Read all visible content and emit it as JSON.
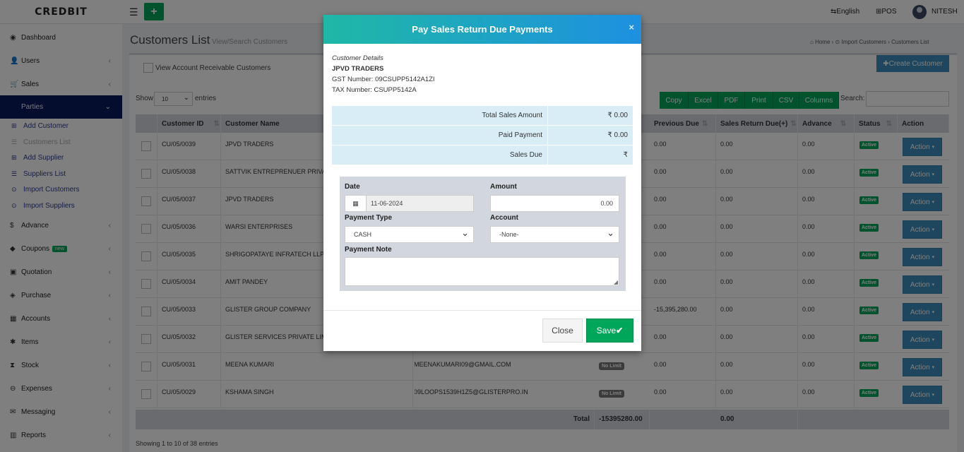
{
  "header": {
    "logo": "CREDBIT",
    "language": "English",
    "pos": "POS",
    "user": "NITESH"
  },
  "sidebar": {
    "items": [
      {
        "label": "Dashboard",
        "icon": "dashboard-icon"
      },
      {
        "label": "Users",
        "icon": "users-icon"
      },
      {
        "label": "Sales",
        "icon": "cart-icon"
      },
      {
        "label": "Parties",
        "icon": "parties-icon"
      },
      {
        "label": "Advance",
        "icon": "dollar-icon"
      },
      {
        "label": "Coupons",
        "icon": "coupon-icon",
        "badge": "new"
      },
      {
        "label": "Quotation",
        "icon": "quotation-icon"
      },
      {
        "label": "Purchase",
        "icon": "purchase-icon"
      },
      {
        "label": "Accounts",
        "icon": "accounts-icon"
      },
      {
        "label": "Items",
        "icon": "items-icon"
      },
      {
        "label": "Stock",
        "icon": "stock-icon"
      },
      {
        "label": "Expenses",
        "icon": "expenses-icon"
      },
      {
        "label": "Messaging",
        "icon": "envelope-icon"
      },
      {
        "label": "Reports",
        "icon": "reports-icon"
      }
    ],
    "subitems": [
      {
        "label": "Add Customer"
      },
      {
        "label": "Customers List"
      },
      {
        "label": "Add Supplier"
      },
      {
        "label": "Suppliers List"
      },
      {
        "label": "Import Customers"
      },
      {
        "label": "Import Suppliers"
      }
    ]
  },
  "page": {
    "title": "Customers List",
    "subtitle": "View/Search Customers",
    "breadcrumb": [
      "Home",
      "Import Customers",
      "Customers List"
    ],
    "receivable_label": "View Account Receivable Customers",
    "create_label": "Create Customer",
    "show_label": "Show",
    "entries_value": "10",
    "entries_label": "entries",
    "export_buttons": [
      "Copy",
      "Excel",
      "PDF",
      "Print",
      "CSV",
      "Columns"
    ],
    "search_label": "Search:"
  },
  "table": {
    "columns": [
      "Customer ID",
      "Customer Name",
      "Previous Due",
      "Sales Return Due(+)",
      "Advance",
      "Status",
      "Action"
    ],
    "rows": [
      {
        "id": "CU/05/0039",
        "name": "JPVD TRADERS",
        "email": "",
        "limit": "",
        "prev": "0.00",
        "ret": "0.00",
        "adv": "0.00",
        "status": "Active",
        "action": "Action"
      },
      {
        "id": "CU/05/0038",
        "name": "SATTVIK ENTREPRENUER PRIVAT",
        "email": "",
        "limit": "",
        "prev": "0.00",
        "ret": "0.00",
        "adv": "0.00",
        "status": "Active",
        "action": "Action"
      },
      {
        "id": "CU/05/0037",
        "name": "JPVD TRADERS",
        "email": "",
        "limit": "",
        "prev": "0.00",
        "ret": "0.00",
        "adv": "0.00",
        "status": "Active",
        "action": "Action"
      },
      {
        "id": "CU/05/0036",
        "name": "WARSI ENTERPRISES",
        "email": "",
        "limit": "",
        "prev": "0.00",
        "ret": "0.00",
        "adv": "0.00",
        "status": "Active",
        "action": "Action"
      },
      {
        "id": "CU/05/0035",
        "name": "SHRIGOPATAYE INFRATECH LLP",
        "email": "",
        "limit": "",
        "prev": "0.00",
        "ret": "0.00",
        "adv": "0.00",
        "status": "Active",
        "action": "Action"
      },
      {
        "id": "CU/05/0034",
        "name": "AMIT PANDEY",
        "email": "",
        "limit": "",
        "prev": "0.00",
        "ret": "0.00",
        "adv": "0.00",
        "status": "Active",
        "action": "Action"
      },
      {
        "id": "CU/05/0033",
        "name": "GLISTER GROUP COMPANY",
        "email": "",
        "limit": "",
        "prev": "-15,395,280.00",
        "ret": "0.00",
        "adv": "0.00",
        "status": "Active",
        "action": "Action"
      },
      {
        "id": "CU/05/0032",
        "name": "GLISTER SERVICES PRIVATE LIMI",
        "email": "",
        "limit": "",
        "prev": "0.00",
        "ret": "0.00",
        "adv": "0.00",
        "status": "Active",
        "action": "Action"
      },
      {
        "id": "CU/05/0031",
        "name": "MEENA KUMARI",
        "email": "MEENAKUMARI09@GMAIL.COM",
        "limit": "No Limit",
        "prev": "0.00",
        "ret": "0.00",
        "adv": "0.00",
        "status": "Active",
        "action": "Action"
      },
      {
        "id": "CU/05/0029",
        "name": "KSHAMA SINGH",
        "email": "09LOOPS1539H1Z5@GLISTERPRO.IN",
        "limit": "No Limit",
        "prev": "0.00",
        "ret": "0.00",
        "adv": "0.00",
        "status": "Active",
        "action": "Action"
      }
    ],
    "footer": {
      "label": "Total",
      "total_prev": "-15395280.00",
      "total_ret": "0.00"
    },
    "showing": "Showing 1 to 10 of 38 entries"
  },
  "modal": {
    "title": "Pay Sales Return Due Payments",
    "close_x": "×",
    "customer_details_label": "Customer Details",
    "customer_name": "JPVD TRADERS",
    "gst": "GST Number: 09CSUPP5142A1ZI",
    "tax": "TAX Number: CSUPP5142A",
    "summary": [
      {
        "label": "Total Sales Amount",
        "value": "₹ 0.00"
      },
      {
        "label": "Paid Payment",
        "value": "₹ 0.00"
      },
      {
        "label": "Sales Due",
        "value": "₹"
      }
    ],
    "form": {
      "date_label": "Date",
      "date_value": "11-06-2024",
      "amount_label": "Amount",
      "amount_value": "0.00",
      "payment_type_label": "Payment Type",
      "payment_type_value": "CASH",
      "account_label": "Account",
      "account_value": "-None-",
      "note_label": "Payment Note"
    },
    "close_label": "Close",
    "save_label": "Save"
  },
  "colors": {
    "accent": "#00a65a",
    "primary": "#3c8dbc",
    "sidebar_active": "#0a1a5c"
  }
}
